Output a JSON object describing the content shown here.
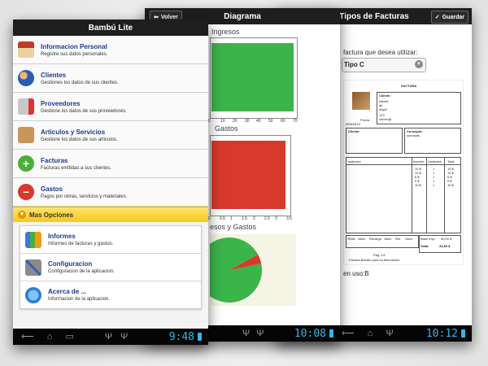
{
  "phones": [
    {
      "app_title": "Bambú Lite",
      "clock": "9:48",
      "menu": [
        {
          "title": "Informacion Personal",
          "subtitle": "Registre sus datos personales."
        },
        {
          "title": "Clientes",
          "subtitle": "Gestiones los datos de sus clientes."
        },
        {
          "title": "Proveedores",
          "subtitle": "Gestione los datos de sus proveedores."
        },
        {
          "title": "Articulos y Servicios",
          "subtitle": "Gestione los datos de sus articulos."
        },
        {
          "title": "Facturas",
          "subtitle": "Facturas emitidas a sus clientes."
        },
        {
          "title": "Gastos",
          "subtitle": "Pagos por obras, servicios y materiales."
        }
      ],
      "mas_opciones": "Mas Opciones",
      "submenu": [
        {
          "title": "Informes",
          "subtitle": "Informes de facturas y gastos."
        },
        {
          "title": "Configuracion",
          "subtitle": "Configuracion de la aplicacion."
        },
        {
          "title": "Acerca de ...",
          "subtitle": "Informacion de la aplicacion."
        }
      ]
    },
    {
      "app_title": "Diagrama",
      "back_label": "Volver",
      "clock": "10:08",
      "chart_titles": [
        "Ingresos",
        "Gastos",
        "esos y Gastos"
      ]
    },
    {
      "app_title": "Tipos de Facturas",
      "save_label": "Guardar",
      "clock": "10:12",
      "prompt": "factura que desea utilizar:",
      "selected_type": "Tipo C",
      "invoice": {
        "heading": "FACTURA",
        "client_label": "Cliente:",
        "client_lines": [
          "cliente",
          "dir",
          "ddyyf"
        ],
        "client_number": "123",
        "client_email": "correo@",
        "fecha_label": "Fecha",
        "date": "9/05/2014",
        "cliente2_label": "Cliente:",
        "concepto_label": "Concepto:",
        "concepto_value": "concepto",
        "col_desc": "scripcion",
        "col_importe": "Importe",
        "col_unidades": "Unidades",
        "col_total": "Total",
        "importes": [
          "10 $",
          "12 $",
          "6 $",
          "0 $",
          "10 $"
        ],
        "unidades": [
          "1",
          "1",
          "1",
          "1",
          "1"
        ],
        "totales": [
          "10 $",
          "12 $",
          "6 $",
          "0 $",
          "10 $"
        ],
        "summary_headers": [
          "%IVA",
          "Valor",
          "Recargo",
          "Valor",
          "Ret",
          "Valor"
        ],
        "base_label": "Base Imp.:",
        "base_value": "30,00 $",
        "total_label": "Total:",
        "total_value": "34,35 $",
        "page": "Pag. 1/1",
        "footer": "Factura Bambu para su facturacion"
      },
      "en_uso": "en uso:B"
    }
  ],
  "chart_data": [
    {
      "type": "bar",
      "title": "Ingresos",
      "categories": [
        ""
      ],
      "values": [
        68
      ],
      "xlim": [
        0,
        70
      ],
      "ticks": [
        "0",
        "10",
        "20",
        "30",
        "40",
        "50",
        "60",
        "70"
      ],
      "color": "#3bb44a",
      "orientation": "horizontal"
    },
    {
      "type": "bar",
      "title": "Gastos",
      "categories": [
        ""
      ],
      "values": [
        3.3
      ],
      "xlim": [
        0,
        3.5
      ],
      "ticks": [
        "0",
        "0.5",
        "1",
        "1.5",
        "2",
        "2.5",
        "3",
        "3.5"
      ],
      "color": "#d9392b",
      "orientation": "horizontal"
    },
    {
      "type": "pie",
      "title": "esos y Gastos",
      "labels": [
        "Ingresos",
        "Gastos"
      ],
      "values": [
        68,
        3.3
      ],
      "colors": [
        "#3bb44a",
        "#d9392b"
      ]
    }
  ],
  "colors": {
    "accent_clock": "#33b5e5",
    "title_blue": "#1a3a8c",
    "mas_yellow": "#f7c81e"
  }
}
